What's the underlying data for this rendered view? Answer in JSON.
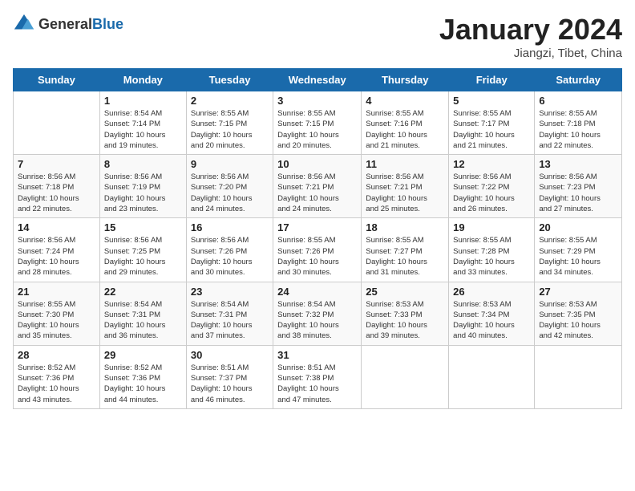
{
  "logo": {
    "text_general": "General",
    "text_blue": "Blue"
  },
  "header": {
    "month": "January 2024",
    "location": "Jiangzi, Tibet, China"
  },
  "weekdays": [
    "Sunday",
    "Monday",
    "Tuesday",
    "Wednesday",
    "Thursday",
    "Friday",
    "Saturday"
  ],
  "weeks": [
    [
      {
        "day": "",
        "info": ""
      },
      {
        "day": "1",
        "info": "Sunrise: 8:54 AM\nSunset: 7:14 PM\nDaylight: 10 hours\nand 19 minutes."
      },
      {
        "day": "2",
        "info": "Sunrise: 8:55 AM\nSunset: 7:15 PM\nDaylight: 10 hours\nand 20 minutes."
      },
      {
        "day": "3",
        "info": "Sunrise: 8:55 AM\nSunset: 7:15 PM\nDaylight: 10 hours\nand 20 minutes."
      },
      {
        "day": "4",
        "info": "Sunrise: 8:55 AM\nSunset: 7:16 PM\nDaylight: 10 hours\nand 21 minutes."
      },
      {
        "day": "5",
        "info": "Sunrise: 8:55 AM\nSunset: 7:17 PM\nDaylight: 10 hours\nand 21 minutes."
      },
      {
        "day": "6",
        "info": "Sunrise: 8:55 AM\nSunset: 7:18 PM\nDaylight: 10 hours\nand 22 minutes."
      }
    ],
    [
      {
        "day": "7",
        "info": "Sunrise: 8:56 AM\nSunset: 7:18 PM\nDaylight: 10 hours\nand 22 minutes."
      },
      {
        "day": "8",
        "info": "Sunrise: 8:56 AM\nSunset: 7:19 PM\nDaylight: 10 hours\nand 23 minutes."
      },
      {
        "day": "9",
        "info": "Sunrise: 8:56 AM\nSunset: 7:20 PM\nDaylight: 10 hours\nand 24 minutes."
      },
      {
        "day": "10",
        "info": "Sunrise: 8:56 AM\nSunset: 7:21 PM\nDaylight: 10 hours\nand 24 minutes."
      },
      {
        "day": "11",
        "info": "Sunrise: 8:56 AM\nSunset: 7:21 PM\nDaylight: 10 hours\nand 25 minutes."
      },
      {
        "day": "12",
        "info": "Sunrise: 8:56 AM\nSunset: 7:22 PM\nDaylight: 10 hours\nand 26 minutes."
      },
      {
        "day": "13",
        "info": "Sunrise: 8:56 AM\nSunset: 7:23 PM\nDaylight: 10 hours\nand 27 minutes."
      }
    ],
    [
      {
        "day": "14",
        "info": "Sunrise: 8:56 AM\nSunset: 7:24 PM\nDaylight: 10 hours\nand 28 minutes."
      },
      {
        "day": "15",
        "info": "Sunrise: 8:56 AM\nSunset: 7:25 PM\nDaylight: 10 hours\nand 29 minutes."
      },
      {
        "day": "16",
        "info": "Sunrise: 8:56 AM\nSunset: 7:26 PM\nDaylight: 10 hours\nand 30 minutes."
      },
      {
        "day": "17",
        "info": "Sunrise: 8:55 AM\nSunset: 7:26 PM\nDaylight: 10 hours\nand 30 minutes."
      },
      {
        "day": "18",
        "info": "Sunrise: 8:55 AM\nSunset: 7:27 PM\nDaylight: 10 hours\nand 31 minutes."
      },
      {
        "day": "19",
        "info": "Sunrise: 8:55 AM\nSunset: 7:28 PM\nDaylight: 10 hours\nand 33 minutes."
      },
      {
        "day": "20",
        "info": "Sunrise: 8:55 AM\nSunset: 7:29 PM\nDaylight: 10 hours\nand 34 minutes."
      }
    ],
    [
      {
        "day": "21",
        "info": "Sunrise: 8:55 AM\nSunset: 7:30 PM\nDaylight: 10 hours\nand 35 minutes."
      },
      {
        "day": "22",
        "info": "Sunrise: 8:54 AM\nSunset: 7:31 PM\nDaylight: 10 hours\nand 36 minutes."
      },
      {
        "day": "23",
        "info": "Sunrise: 8:54 AM\nSunset: 7:31 PM\nDaylight: 10 hours\nand 37 minutes."
      },
      {
        "day": "24",
        "info": "Sunrise: 8:54 AM\nSunset: 7:32 PM\nDaylight: 10 hours\nand 38 minutes."
      },
      {
        "day": "25",
        "info": "Sunrise: 8:53 AM\nSunset: 7:33 PM\nDaylight: 10 hours\nand 39 minutes."
      },
      {
        "day": "26",
        "info": "Sunrise: 8:53 AM\nSunset: 7:34 PM\nDaylight: 10 hours\nand 40 minutes."
      },
      {
        "day": "27",
        "info": "Sunrise: 8:53 AM\nSunset: 7:35 PM\nDaylight: 10 hours\nand 42 minutes."
      }
    ],
    [
      {
        "day": "28",
        "info": "Sunrise: 8:52 AM\nSunset: 7:36 PM\nDaylight: 10 hours\nand 43 minutes."
      },
      {
        "day": "29",
        "info": "Sunrise: 8:52 AM\nSunset: 7:36 PM\nDaylight: 10 hours\nand 44 minutes."
      },
      {
        "day": "30",
        "info": "Sunrise: 8:51 AM\nSunset: 7:37 PM\nDaylight: 10 hours\nand 46 minutes."
      },
      {
        "day": "31",
        "info": "Sunrise: 8:51 AM\nSunset: 7:38 PM\nDaylight: 10 hours\nand 47 minutes."
      },
      {
        "day": "",
        "info": ""
      },
      {
        "day": "",
        "info": ""
      },
      {
        "day": "",
        "info": ""
      }
    ]
  ]
}
